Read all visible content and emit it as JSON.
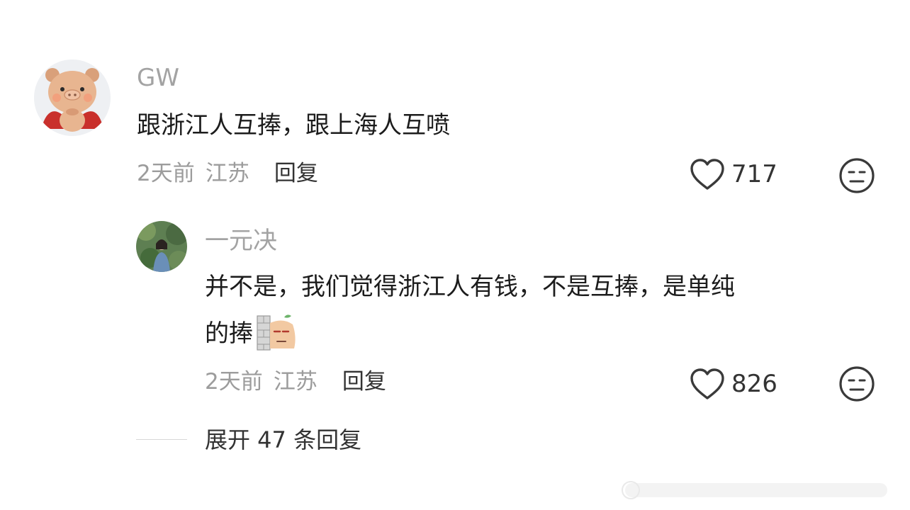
{
  "comments": [
    {
      "username": "GW",
      "text": "跟浙江人互捧，跟上海人互喷",
      "time": "2天前",
      "location": "江苏",
      "reply_label": "回复",
      "likes": "717",
      "avatar_icon": "pig-avatar"
    }
  ],
  "replies": [
    {
      "username": "一元决",
      "text_line1": "并不是，我们觉得浙江人有钱，不是互捧，是单纯",
      "text_line2": "的捧",
      "time": "2天前",
      "location": "江苏",
      "reply_label": "回复",
      "likes": "826",
      "avatar_icon": "photo-avatar",
      "sticker_icon": "peeking-face-sticker"
    }
  ],
  "expand": {
    "label": "展开 47 条回复"
  },
  "colors": {
    "meta": "#9c9c9c",
    "username": "#a3a3a3",
    "text": "#1c1c1c",
    "icon": "#3a3a3a"
  }
}
